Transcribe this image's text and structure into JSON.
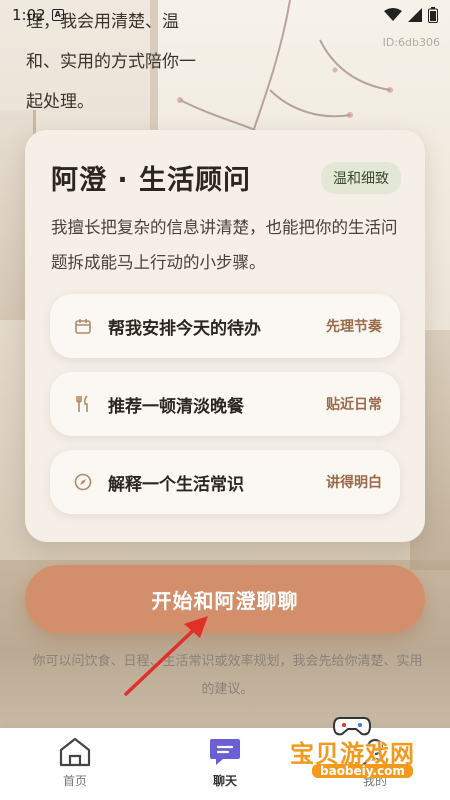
{
  "status_bar": {
    "time": "1:02",
    "notif_icon": "a-icon",
    "wifi_icon": "wifi-icon",
    "signal_icon": "signal-icon",
    "battery_icon": "battery-icon"
  },
  "device_id": "ID:6db306",
  "intro_lines": [
    "理，我会用清楚、温",
    "和、实用的方式陪你一",
    "起处理。"
  ],
  "card": {
    "title": "阿澄 · 生活顾问",
    "tag": "温和细致",
    "description": "我擅长把复杂的信息讲清楚，也能把你的生活问题拆成能马上行动的小步骤。",
    "options": [
      {
        "icon": "calendar-icon",
        "label": "帮我安排今天的待办",
        "hint": "先理节奏"
      },
      {
        "icon": "utensils-icon",
        "label": "推荐一顿清淡晚餐",
        "hint": "贴近日常"
      },
      {
        "icon": "compass-icon",
        "label": "解释一个生活常识",
        "hint": "讲得明白"
      }
    ]
  },
  "cta": {
    "label": "开始和阿澄聊聊"
  },
  "footnote": "你可以问饮食、日程、生活常识或效率规划，我会先给你清楚、实用的建议。",
  "bottom_nav": [
    {
      "icon": "home-icon",
      "label": "首页",
      "active": false
    },
    {
      "icon": "chat-icon",
      "label": "聊天",
      "active": true
    },
    {
      "icon": "profile-icon",
      "label": "我的",
      "active": false
    }
  ],
  "watermark": {
    "text": "宝贝游戏网",
    "url": "baobeiy.com"
  },
  "colors": {
    "accent": "#d38f6b",
    "card_bg": "#f5efe7",
    "tag_bg": "#e3e7d5",
    "hint": "#9a6a4a",
    "chat_active": "#6b5fd6"
  }
}
